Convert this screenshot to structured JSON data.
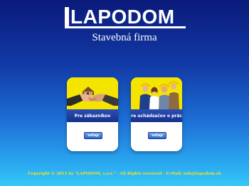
{
  "header": {
    "logo_text": "LAPODOM",
    "subtitle": "Stavebná firma"
  },
  "cards": [
    {
      "label": "Pre zákazníkov",
      "button": "vstup",
      "image_icon": "handshake-icon"
    },
    {
      "label": "Pre uchádzačov o prácu",
      "button": "vstup",
      "image_icon": "workers-icon"
    }
  ],
  "footer": {
    "text": "Copyright © 2013 by \"LAPODOM, s.r.o.\" - All Rights reserved - E-Mail: info@lapodom.sk"
  },
  "colors": {
    "card_image_bg": "#f4e400",
    "card_label_bg": "#1a3a9e",
    "footer_text": "#f6e11a"
  }
}
